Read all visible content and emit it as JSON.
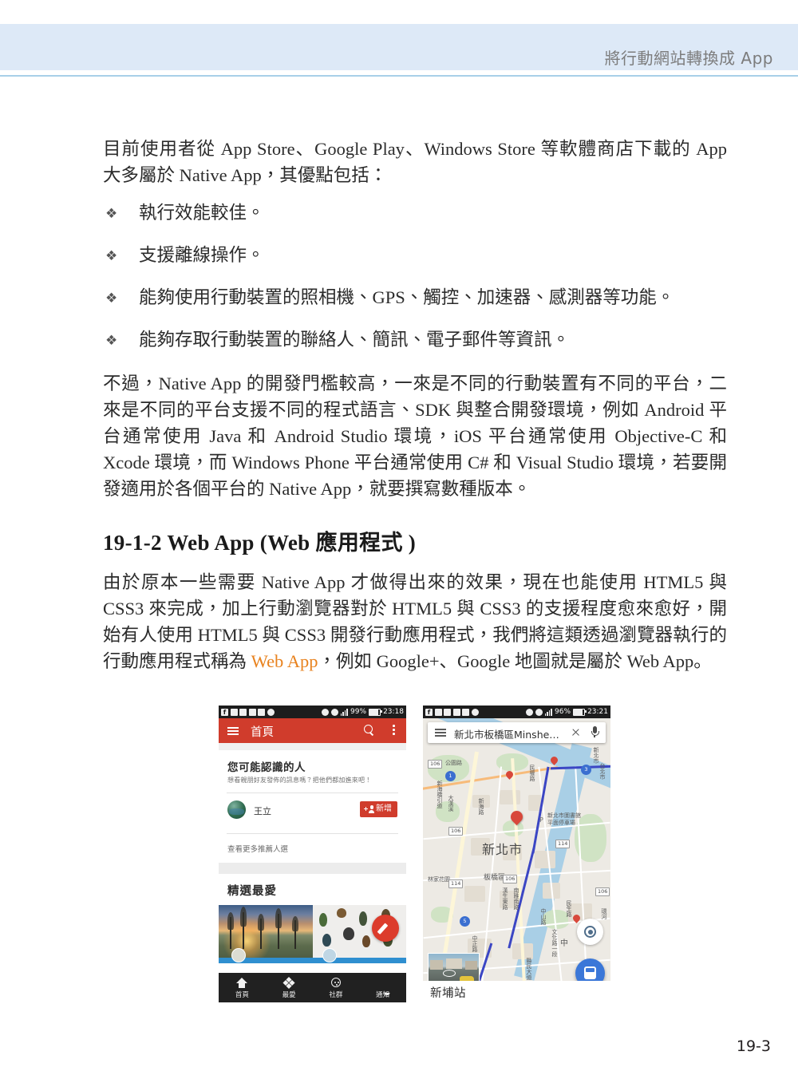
{
  "header": {
    "running_title": "將行動網站轉換成 App"
  },
  "content": {
    "paragraph_1": "目前使用者從 App Store、Google Play、Windows Store 等軟體商店下載的 App 大多屬於 Native App，其優點包括：",
    "bullets": [
      {
        "mark": "❖",
        "text": "執行效能較佳。"
      },
      {
        "mark": "❖",
        "text": "支援離線操作。"
      },
      {
        "mark": "❖",
        "text": "能夠使用行動裝置的照相機、GPS、觸控、加速器、感測器等功能。"
      },
      {
        "mark": "❖",
        "text": "能夠存取行動裝置的聯絡人、簡訊、電子郵件等資訊。"
      }
    ],
    "paragraph_2": "不過，Native App 的開發門檻較高，一來是不同的行動裝置有不同的平台，二來是不同的平台支援不同的程式語言、SDK 與整合開發環境，例如 Android 平台通常使用 Java 和 Android Studio 環境，iOS 平台通常使用 Objective-C 和 Xcode 環境，而 Windows Phone 平台通常使用 C# 和 Visual Studio 環境，若要開發適用於各個平台的 Native App，就要撰寫數種版本。",
    "section_heading": "19-1-2 Web App (Web 應用程式 )",
    "paragraph_3_part1": "由於原本一些需要 Native App 才做得出來的效果，現在也能使用 HTML5 與 CSS3 來完成，加上行動瀏覽器對於 HTML5 與 CSS3 的支援程度愈來愈好，開始有人使用 HTML5 與 CSS3 開發行動應用程式，我們將這類透過瀏覽器執行的行動應用程式稱為 ",
    "paragraph_3_accent": "Web App",
    "paragraph_3_part2": "，例如 Google+、Google 地圖就是屬於 Web App。",
    "accent_color": "#e8821e"
  },
  "figure": {
    "phone_left": {
      "status_bar": {
        "battery": "99%",
        "time": "23:18"
      },
      "app_bar": {
        "title": "首頁"
      },
      "people_card": {
        "heading": "您可能認識的人",
        "subtitle": "想看親朋好友發佈的訊息嗎？把他們都加進來吧！",
        "contact_name": "王立",
        "add_label": "新增",
        "more_link": "查看更多推薦人選"
      },
      "favorites": {
        "heading": "精選最愛"
      },
      "bottom_nav": [
        {
          "label": "首頁",
          "icon": "home-icon"
        },
        {
          "label": "最愛",
          "icon": "diamonds-icon"
        },
        {
          "label": "社群",
          "icon": "community-icon"
        },
        {
          "label": "通知",
          "icon": "bell-icon"
        }
      ]
    },
    "phone_right": {
      "status_bar": {
        "battery": "96%",
        "time": "23:21"
      },
      "search": {
        "query": "新北市板橋區Minshe…"
      },
      "map_labels": {
        "city": "新北市",
        "district": "板橋區",
        "poi": "新北市圖書館\n平面停車場",
        "parking_mark": "P",
        "park": "林家花園",
        "road_a": "公園路",
        "road_b": "新海路",
        "road_c": "中正路",
        "road_d": "民權路",
        "road_e": "文化路一段",
        "road_f": "縣民大道三段",
        "road_g": "新北市",
        "road_h": "台北市",
        "road_i": "新海橋引道",
        "road_j": "大漢溪",
        "road_k": "漢生東路",
        "road_l": "南雅南路",
        "road_m": "中山路",
        "road_n": "民生路",
        "road_o": "中",
        "road_p": "環河",
        "shield_106a": "106",
        "shield_106b": "106",
        "shield_106c": "106",
        "shield_106d": "106",
        "shield_114a": "114",
        "shield_114b": "114",
        "shield_round_a": "1",
        "shield_round_b": "3",
        "shield_round_c": "5"
      },
      "place_bar": {
        "name": "新埔站"
      }
    }
  },
  "footer": {
    "page_number": "19-3"
  }
}
